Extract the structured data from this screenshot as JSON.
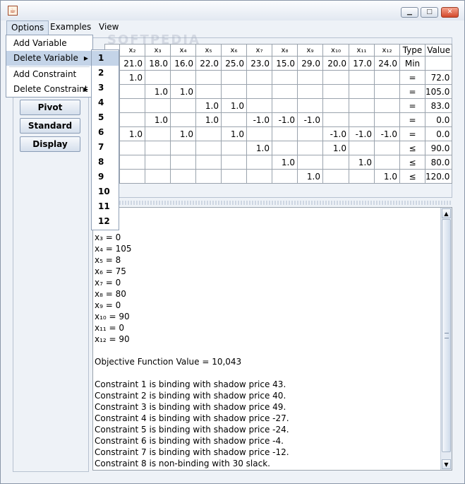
{
  "window": {
    "title": "",
    "minimize": "▁",
    "maximize": "□",
    "close": "✕"
  },
  "menubar": {
    "items": [
      "Options",
      "Examples",
      "View"
    ]
  },
  "options_menu": {
    "items": [
      {
        "label": "Add Variable",
        "submenu": false
      },
      {
        "label": "Delete Variable",
        "submenu": true
      },
      {
        "label": "Add Constraint",
        "submenu": false
      },
      {
        "label": "Delete Constraint",
        "submenu": true
      }
    ],
    "arrow": "▶"
  },
  "delete_variable_submenu": {
    "items": [
      "1",
      "2",
      "3",
      "4",
      "5",
      "6",
      "7",
      "8",
      "9",
      "10",
      "11",
      "12"
    ]
  },
  "side_buttons": [
    "Pivot",
    "Standard",
    "Display"
  ],
  "table": {
    "headers": [
      "x₂",
      "x₃",
      "x₄",
      "x₅",
      "x₆",
      "x₇",
      "x₈",
      "x₉",
      "x₁₀",
      "x₁₁",
      "x₁₂",
      "Type",
      "Value"
    ],
    "rows": [
      [
        "21.0",
        "18.0",
        "16.0",
        "22.0",
        "25.0",
        "23.0",
        "15.0",
        "29.0",
        "20.0",
        "17.0",
        "24.0",
        "Min",
        ""
      ],
      [
        "1.0",
        "",
        "",
        "",
        "",
        "",
        "",
        "",
        "",
        "",
        "",
        "=",
        "72.0"
      ],
      [
        "",
        "1.0",
        "1.0",
        "",
        "",
        "",
        "",
        "",
        "",
        "",
        "",
        "=",
        "105.0"
      ],
      [
        "",
        "",
        "",
        "1.0",
        "1.0",
        "",
        "",
        "",
        "",
        "",
        "",
        "=",
        "83.0"
      ],
      [
        "",
        "1.0",
        "",
        "1.0",
        "",
        "-1.0",
        "-1.0",
        "-1.0",
        "",
        "",
        "",
        "=",
        "0.0"
      ],
      [
        "1.0",
        "",
        "1.0",
        "",
        "1.0",
        "",
        "",
        "",
        "-1.0",
        "-1.0",
        "-1.0",
        "=",
        "0.0"
      ],
      [
        "",
        "",
        "",
        "",
        "",
        "1.0",
        "",
        "",
        "1.0",
        "",
        "",
        "≤",
        "90.0"
      ],
      [
        "",
        "",
        "",
        "",
        "",
        "",
        "1.0",
        "",
        "",
        "1.0",
        "",
        "≤",
        "80.0"
      ],
      [
        "",
        "",
        "",
        "",
        "",
        "",
        "",
        "1.0",
        "",
        "",
        "1.0",
        "≤",
        "120.0"
      ]
    ]
  },
  "output": {
    "lines": [
      "x₃ = 0",
      "x₄ = 105",
      "x₅ = 8",
      "x₆ = 75",
      "x₇ = 0",
      "x₈ = 80",
      "x₉ = 0",
      "x₁₀ = 90",
      "x₁₁ = 0",
      "x₁₂ = 90",
      "",
      "Objective Function Value = 10,043",
      "",
      "Constraint 1 is binding with shadow price 43.",
      "Constraint 2 is binding with shadow price 40.",
      "Constraint 3 is binding with shadow price 49.",
      "Constraint 4 is binding with shadow price -27.",
      "Constraint 5 is binding with shadow price -24.",
      "Constraint 6 is binding with shadow price -4.",
      "Constraint 7 is binding with shadow price -12.",
      "Constraint 8 is non-binding with 30 slack."
    ],
    "scroll_up": "▲",
    "scroll_down": "▼"
  }
}
